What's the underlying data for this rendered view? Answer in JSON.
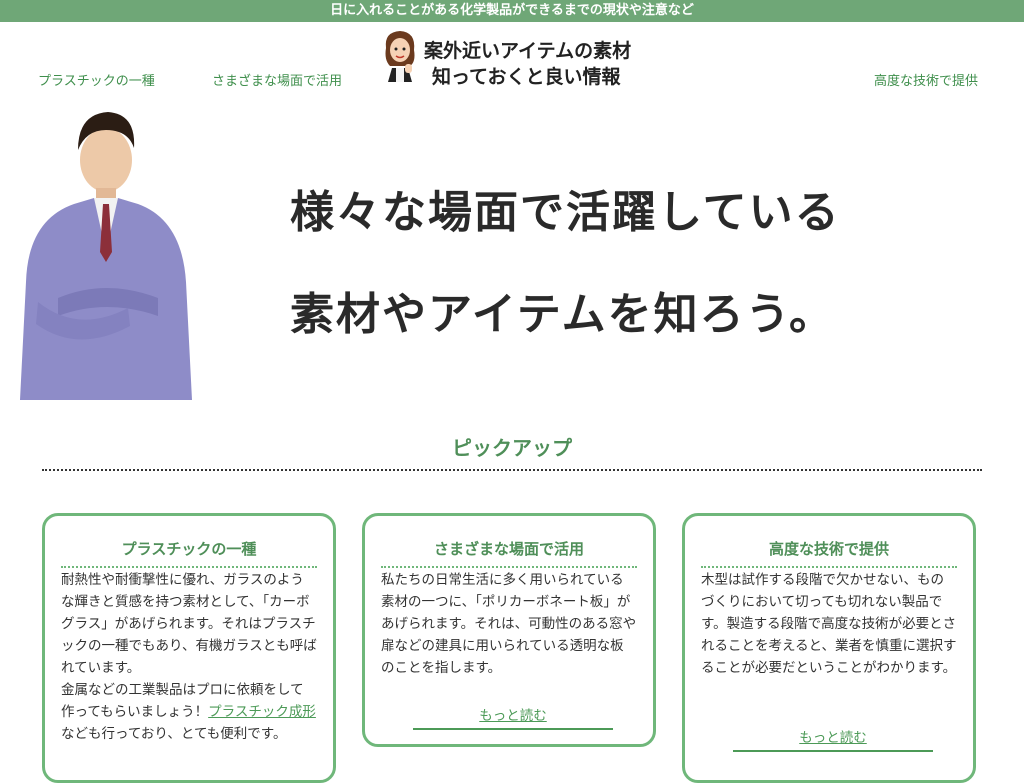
{
  "header": {
    "tagline": "日に入れることがある化学製品ができるまでの現状や注意など",
    "logo": {
      "line1": "案外近いアイテムの素材",
      "line2": "知っておくと良い情報"
    },
    "nav": [
      {
        "label": "プラスチックの一種"
      },
      {
        "label": "さまざまな場面で活用"
      },
      {
        "label": "高度な技術で提供"
      }
    ]
  },
  "hero": {
    "line1": "様々な場面で活躍している",
    "line2": "素材やアイテムを知ろう。"
  },
  "pickup": {
    "title": "ピックアップ",
    "cards": [
      {
        "title": "プラスチックの一種",
        "text1": "耐熱性や耐衝撃性に優れ、ガラスのような輝きと質感を持つ素材として、「カーボグラス」があげられます。それはプラスチックの一種でもあり、有機ガラスとも呼ばれています。",
        "text2a": "金属などの工業製品はプロに依頼をして作ってもらいましょう！",
        "link": "プラスチック成形",
        "text2b": "なども行っており、とても便利です。"
      },
      {
        "title": "さまざまな場面で活用",
        "text1": "私たちの日常生活に多く用いられている素材の一つに、「ポリカーボネート板」があげられます。それは、可動性のある窓や扉などの建具に用いられている透明な板のことを指します。",
        "more": "もっと読む"
      },
      {
        "title": "高度な技術で提供",
        "text1": "木型は試作する段階で欠かせない、ものづくりにおいて切っても切れない製品です。製造する段階で高度な技術が必要とされることを考えると、業者を慎重に選択することが必要だということがわかります。",
        "more": "もっと読む"
      }
    ]
  },
  "colors": {
    "accent": "#6fa777",
    "link": "#4c9a57",
    "card_border": "#6fb77a"
  }
}
